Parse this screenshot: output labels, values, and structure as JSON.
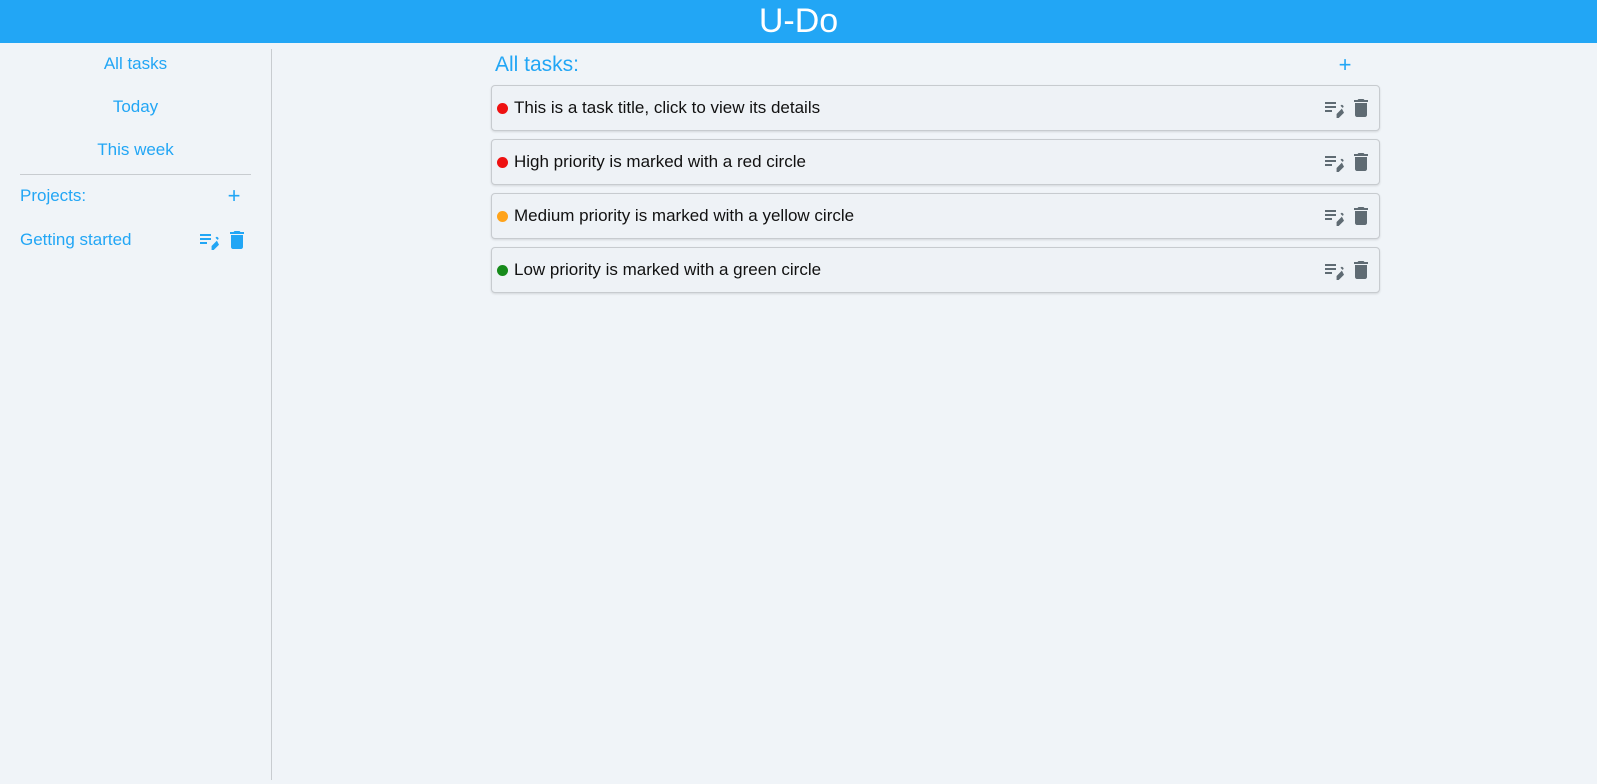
{
  "app": {
    "title": "U-Do"
  },
  "sidebar": {
    "nav": [
      {
        "label": "All tasks"
      },
      {
        "label": "Today"
      },
      {
        "label": "This week"
      }
    ],
    "projects_label": "Projects:",
    "add_project_symbol": "+",
    "projects": [
      {
        "label": "Getting started"
      }
    ]
  },
  "main": {
    "title": "All tasks:",
    "add_task_symbol": "+",
    "tasks": [
      {
        "title": "This is a task title, click to view its details",
        "priority": "high",
        "color": "#ee1111"
      },
      {
        "title": "High priority is marked with a red circle",
        "priority": "high",
        "color": "#ee1111"
      },
      {
        "title": "Medium priority is marked with a yellow circle",
        "priority": "medium",
        "color": "#ffa31a"
      },
      {
        "title": "Low priority is marked with a green circle",
        "priority": "low",
        "color": "#168a1a"
      }
    ]
  },
  "colors": {
    "accent": "#22a6f5",
    "background": "#f0f4f8",
    "icon_gray": "#5f6b73"
  }
}
